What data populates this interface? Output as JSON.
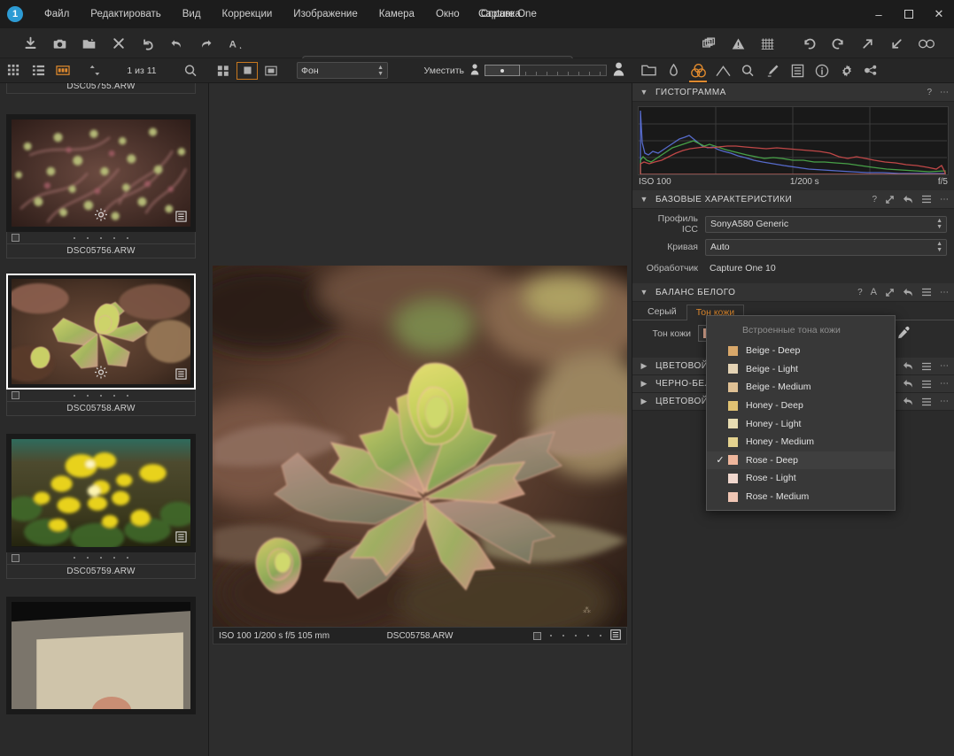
{
  "window": {
    "title": "Capture One",
    "logo_text": "1",
    "controls": {
      "minimize": "–",
      "maximize": "❐",
      "close": "✕"
    }
  },
  "menu": {
    "items": [
      {
        "label": "Файл"
      },
      {
        "label": "Редактировать"
      },
      {
        "label": "Вид"
      },
      {
        "label": "Коррекции"
      },
      {
        "label": "Изображение"
      },
      {
        "label": "Камера"
      },
      {
        "label": "Окно"
      },
      {
        "label": "Справка"
      }
    ]
  },
  "toolbar": {
    "left_buttons": [
      {
        "name": "import-icon"
      },
      {
        "name": "camera-icon"
      },
      {
        "name": "open-folder-icon"
      },
      {
        "name": "delete-icon"
      },
      {
        "name": "undo-all-icon"
      },
      {
        "name": "undo-icon"
      },
      {
        "name": "redo-icon"
      },
      {
        "name": "annotate-text-icon"
      }
    ],
    "tool_palette": [
      {
        "name": "pointer-tool",
        "active": false
      },
      {
        "name": "pan-hand-tool",
        "active": true
      },
      {
        "name": "keystone-tool",
        "active": false
      },
      {
        "name": "crop-tool",
        "active": false
      },
      {
        "name": "rotate-tool",
        "active": false
      },
      {
        "name": "straighten-tool",
        "active": false
      },
      {
        "name": "spot-removal-tool",
        "active": false
      },
      {
        "name": "gradient-mask-tool",
        "active": false
      },
      {
        "name": "draw-mask-tool",
        "active": false
      },
      {
        "name": "erase-mask-tool",
        "active": false
      }
    ],
    "right_buttons": [
      {
        "name": "variants-icon"
      },
      {
        "name": "warning-icon"
      },
      {
        "name": "grid-overlay-icon"
      },
      {
        "name": "rotate-left-icon"
      },
      {
        "name": "rotate-right-icon"
      },
      {
        "name": "export-arrow-icon"
      },
      {
        "name": "import-arrow-icon"
      },
      {
        "name": "proof-glasses-icon"
      }
    ]
  },
  "browse_bar": {
    "view_modes": [
      {
        "name": "grid-view-icon",
        "active": false
      },
      {
        "name": "list-view-icon",
        "active": false
      },
      {
        "name": "filmstrip-view-icon",
        "active": true
      }
    ],
    "sort_icon": "sort-updown-icon",
    "count_text": "1 из 11",
    "search_icon": "search-icon"
  },
  "viewer_bar": {
    "layout_buttons": [
      {
        "name": "multi-view-icon",
        "active": false
      },
      {
        "name": "primary-view-icon",
        "active": true
      },
      {
        "name": "proof-view-icon",
        "active": false
      }
    ],
    "background_select": {
      "value": "Фон"
    },
    "fit_label": "Уместить",
    "zoom_min_icon": "person-small-icon",
    "zoom_max_icon": "person-large-icon"
  },
  "tool_tabs": [
    {
      "name": "library-tab",
      "icon": "folder-icon",
      "active": false
    },
    {
      "name": "capture-tab",
      "icon": "tether-icon",
      "active": false
    },
    {
      "name": "color-tab",
      "icon": "color-circles-icon",
      "active": true
    },
    {
      "name": "exposure-tab",
      "icon": "exposure-icon",
      "active": false
    },
    {
      "name": "details-tab",
      "icon": "magnifier-icon",
      "active": false
    },
    {
      "name": "adjustments-tab",
      "icon": "brush-icon",
      "active": false
    },
    {
      "name": "metadata-tab",
      "icon": "metadata-icon",
      "active": false
    },
    {
      "name": "output-tab",
      "icon": "info-icon",
      "active": false
    },
    {
      "name": "settings-tab",
      "icon": "gear-icon",
      "active": false
    },
    {
      "name": "batch-tab",
      "icon": "batch-icon",
      "active": false
    }
  ],
  "filmstrip": {
    "scrollbar": {
      "up_arrow": "▲",
      "down_arrow": "▼"
    },
    "thumbnails": [
      {
        "filename": "DSC05755.ARW",
        "selected": false,
        "partial_top": true,
        "show_gear": false,
        "show_list": false,
        "rating_dots": 5
      },
      {
        "filename": "DSC05756.ARW",
        "selected": false,
        "partial_top": false,
        "show_gear": true,
        "show_list": true,
        "rating_dots": 5
      },
      {
        "filename": "DSC05758.ARW",
        "selected": true,
        "partial_top": false,
        "show_gear": true,
        "show_list": true,
        "rating_dots": 5
      },
      {
        "filename": "DSC05759.ARW",
        "selected": false,
        "partial_top": false,
        "show_gear": false,
        "show_list": true,
        "rating_dots": 5
      }
    ]
  },
  "viewer": {
    "info_bar": {
      "exif": "ISO 100 1/200 s f/5 105 mm",
      "filename": "DSC05758.ARW",
      "rating_dots": 5,
      "list_icon": "list-icon"
    }
  },
  "panels": {
    "histogram": {
      "title": "ГИСТОГРАММА",
      "help_icon": "?",
      "menu_icon": "⋯",
      "iso_label": "ISO 100",
      "shutter_label": "1/200 s",
      "aperture_label": "f/5"
    },
    "base_characteristics": {
      "title": "БАЗОВЫЕ ХАРАКТЕРИСТИКИ",
      "icc_label": "Профиль ICC",
      "icc_value": "SonyA580 Generic",
      "curve_label": "Кривая",
      "curve_value": "Auto",
      "engine_label": "Обработчик",
      "engine_value": "Capture One 10"
    },
    "white_balance": {
      "title": "БАЛАНС БЕЛОГО",
      "tabs": [
        {
          "label": "Серый",
          "active": false
        },
        {
          "label": "Тон кожи",
          "active": true
        }
      ],
      "skin_label": "Тон кожи",
      "skin_value": "Rose - Deep",
      "skin_swatch": "#efb69c",
      "picker_icon": "eyedropper-icon"
    },
    "collapsed": [
      {
        "title": "ЦВЕТОВОЙ Б"
      },
      {
        "title": "ЧЕРНО-БЕЛЬ"
      },
      {
        "title": "ЦВЕТОВОЙ Р"
      }
    ]
  },
  "skin_dropdown": {
    "header": "Встроенные тона кожи",
    "items": [
      {
        "label": "Beige - Deep",
        "swatch": "#d9a86a",
        "checked": false
      },
      {
        "label": "Beige - Light",
        "swatch": "#e4d3b4",
        "checked": false
      },
      {
        "label": "Beige - Medium",
        "swatch": "#e0c195",
        "checked": false
      },
      {
        "label": "Honey - Deep",
        "swatch": "#e0c273",
        "checked": false
      },
      {
        "label": "Honey - Light",
        "swatch": "#e7dcb2",
        "checked": false
      },
      {
        "label": "Honey - Medium",
        "swatch": "#e4d28f",
        "checked": false
      },
      {
        "label": "Rose - Deep",
        "swatch": "#efb69c",
        "checked": true
      },
      {
        "label": "Rose - Light",
        "swatch": "#f0d7cd",
        "checked": false
      },
      {
        "label": "Rose - Medium",
        "swatch": "#f0c6b4",
        "checked": false
      }
    ],
    "check_glyph": "✓"
  },
  "colors": {
    "accent": "#e08a2e",
    "panel_bg": "#2b2b2b",
    "header_bg": "#333333",
    "titlebar_bg": "#1c1c1c"
  }
}
